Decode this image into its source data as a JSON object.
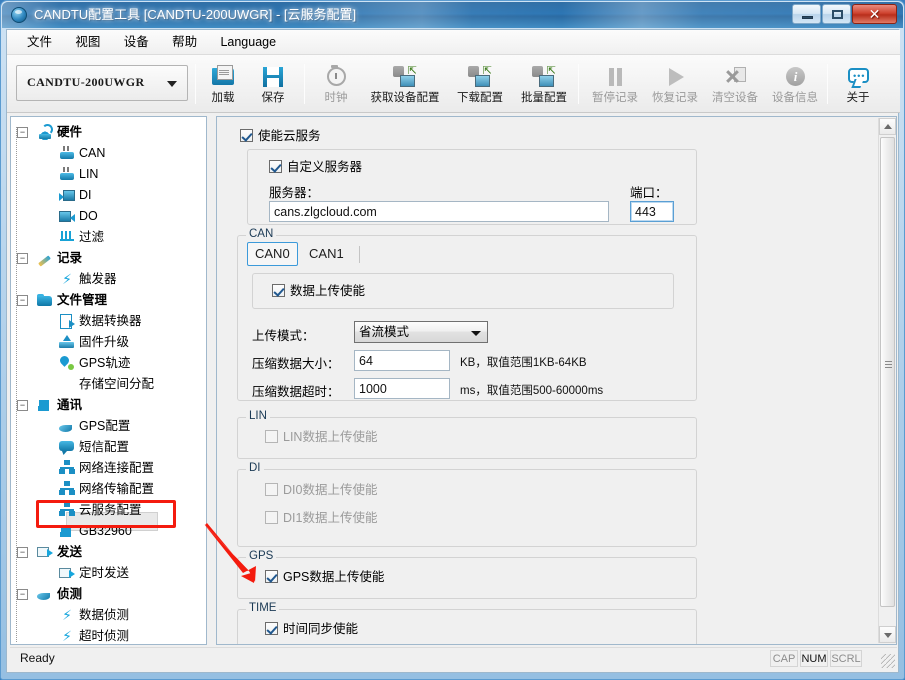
{
  "window": {
    "title": "CANDTU配置工具 [CANDTU-200UWGR] - [云服务配置]",
    "icon": "app-globe-icon",
    "minimize_label": "–",
    "maximize_label": "□",
    "close_label": "✕"
  },
  "menu": {
    "items": [
      {
        "label": "文件"
      },
      {
        "label": "视图"
      },
      {
        "label": "设备"
      },
      {
        "label": "帮助"
      },
      {
        "label": "Language"
      }
    ]
  },
  "toolbar": {
    "device_selector": {
      "value": "CANDTU-200UWGR",
      "icon": "chevron-down-icon"
    },
    "buttons": [
      {
        "label": "加载",
        "icon": "open-folder-icon",
        "enabled": true
      },
      {
        "label": "保存",
        "icon": "floppy-save-icon",
        "enabled": true
      },
      {
        "label": "时钟",
        "icon": "clock-icon",
        "enabled": false
      },
      {
        "label": "获取设备配置",
        "icon": "device-upload-icon",
        "enabled": true
      },
      {
        "label": "下载配置",
        "icon": "device-download-icon",
        "enabled": true
      },
      {
        "label": "批量配置",
        "icon": "device-batch-icon",
        "enabled": true
      },
      {
        "label": "暂停记录",
        "icon": "pause-icon",
        "enabled": false
      },
      {
        "label": "恢复记录",
        "icon": "play-icon",
        "enabled": false
      },
      {
        "label": "清空设备",
        "icon": "clear-device-icon",
        "enabled": false
      },
      {
        "label": "设备信息",
        "icon": "info-circle-icon",
        "enabled": false
      },
      {
        "label": "关于",
        "icon": "about-speech-icon",
        "enabled": true
      }
    ]
  },
  "sidebar": {
    "nodes": [
      {
        "label": "硬件",
        "level": 0,
        "icon": "hardware-icon",
        "expander": "−"
      },
      {
        "label": "CAN",
        "level": 1,
        "icon": "can-device-icon"
      },
      {
        "label": "LIN",
        "level": 1,
        "icon": "lin-device-icon"
      },
      {
        "label": "DI",
        "level": 1,
        "icon": "di-icon"
      },
      {
        "label": "DO",
        "level": 1,
        "icon": "do-icon"
      },
      {
        "label": "过滤",
        "level": 1,
        "icon": "filter-icon"
      },
      {
        "label": "记录",
        "level": 0,
        "icon": "record-pencil-icon",
        "expander": "−"
      },
      {
        "label": "触发器",
        "level": 1,
        "icon": "trigger-bolt-icon"
      },
      {
        "label": "文件管理",
        "level": 0,
        "icon": "folder-icon",
        "expander": "−"
      },
      {
        "label": "数据转换器",
        "level": 1,
        "icon": "data-converter-icon"
      },
      {
        "label": "固件升级",
        "level": 1,
        "icon": "firmware-upgrade-icon"
      },
      {
        "label": "GPS轨迹",
        "level": 1,
        "icon": "gps-track-icon"
      },
      {
        "label": "存储空间分配",
        "level": 1,
        "icon": "storage-pie-icon"
      },
      {
        "label": "通讯",
        "level": 0,
        "icon": "communication-bars-icon",
        "expander": "−"
      },
      {
        "label": "GPS配置",
        "level": 1,
        "icon": "satellite-icon"
      },
      {
        "label": "短信配置",
        "level": 1,
        "icon": "sms-icon"
      },
      {
        "label": "网络连接配置",
        "level": 1,
        "icon": "network-icon"
      },
      {
        "label": "网络传输配置",
        "level": 1,
        "icon": "network-icon"
      },
      {
        "label": "云服务配置",
        "level": 1,
        "icon": "network-icon",
        "selected": true,
        "highlighted": true
      },
      {
        "label": "GB32960",
        "level": 1,
        "icon": "communication-bars-icon"
      },
      {
        "label": "发送",
        "level": 0,
        "icon": "send-icon",
        "expander": "−"
      },
      {
        "label": "定时发送",
        "level": 1,
        "icon": "send-icon"
      },
      {
        "label": "侦测",
        "level": 0,
        "icon": "satellite-icon",
        "expander": "−"
      },
      {
        "label": "数据侦测",
        "level": 1,
        "icon": "trigger-bolt-icon"
      },
      {
        "label": "超时侦测",
        "level": 1,
        "icon": "trigger-bolt-icon"
      }
    ]
  },
  "main": {
    "enable_cloud": {
      "label": "使能云服务",
      "checked": true
    },
    "server_group": {
      "custom_server": {
        "label": "自定义服务器",
        "checked": true
      },
      "server_label": "服务器：",
      "server_value": "cans.zlgcloud.com",
      "port_label": "端口：",
      "port_value": "443"
    },
    "can_group": {
      "title": "CAN",
      "tabs": [
        {
          "label": "CAN0",
          "active": true
        },
        {
          "label": "CAN1",
          "active": false
        }
      ],
      "data_upload": {
        "label": "数据上传使能",
        "checked": true
      },
      "upload_mode_label": "上传模式：",
      "upload_mode_value": "省流模式",
      "compress_size_label": "压缩数据大小：",
      "compress_size_value": "64",
      "compress_size_hint": "KB，取值范围1KB-64KB",
      "compress_timeout_label": "压缩数据超时：",
      "compress_timeout_value": "1000",
      "compress_timeout_hint": "ms，取值范围500-60000ms"
    },
    "lin_group": {
      "title": "LIN",
      "checkbox": {
        "label": "LIN数据上传使能",
        "checked": false,
        "enabled": false
      }
    },
    "di_group": {
      "title": "DI",
      "checkboxes": [
        {
          "label": "DI0数据上传使能",
          "checked": false,
          "enabled": false
        },
        {
          "label": "DI1数据上传使能",
          "checked": false,
          "enabled": false
        }
      ]
    },
    "gps_group": {
      "title": "GPS",
      "checkbox": {
        "label": "GPS数据上传使能",
        "checked": true,
        "enabled": true
      }
    },
    "time_group": {
      "title": "TIME",
      "checkbox": {
        "label": "时间同步使能",
        "checked": true,
        "enabled": true
      }
    }
  },
  "statusbar": {
    "message": "Ready",
    "indicators": [
      {
        "label": "CAP",
        "active": false
      },
      {
        "label": "NUM",
        "active": true
      },
      {
        "label": "SCRL",
        "active": false
      }
    ]
  },
  "annotations": {
    "highlight_color": "#f41b0e",
    "arrow_target": "gps-group"
  }
}
